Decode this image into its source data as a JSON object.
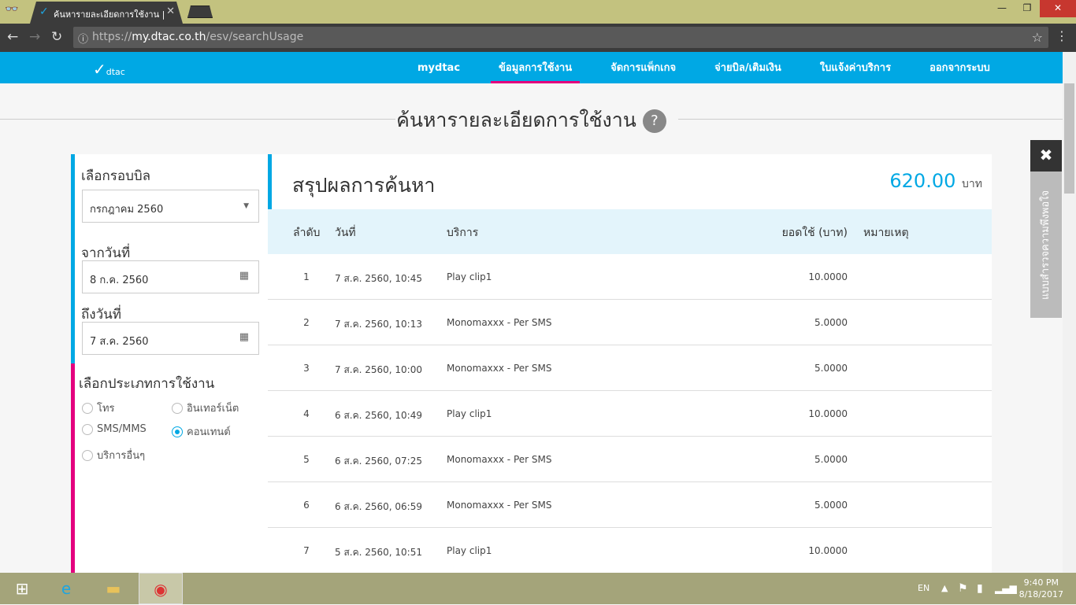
{
  "browser": {
    "tab_title": "ค้นหารายละเอียดการใช้งาน |",
    "url_scheme": "https://",
    "url_host": "my.dtac.co.th",
    "url_path": "/esv/searchUsage"
  },
  "site": {
    "logo": "dtac",
    "nav": [
      "mydtac",
      "ข้อมูลการใช้งาน",
      "จัดการแพ็กเกจ",
      "จ่ายบิล/เติมเงิน",
      "ใบแจ้งค่าบริการ",
      "ออกจากระบบ"
    ]
  },
  "page_title": "ค้นหารายละเอียดการใช้งาน",
  "help": "?",
  "filters": {
    "bill_cycle_label": "เลือกรอบบิล",
    "bill_cycle_value": "กรกฎาคม 2560",
    "from_label": "จากวันที่",
    "from_value": "8 ก.ค. 2560",
    "to_label": "ถึงวันที่",
    "to_value": "7 ส.ค. 2560",
    "type_label": "เลือกประเภทการใช้งาน",
    "types": [
      {
        "label": "โทร",
        "checked": false
      },
      {
        "label": "อินเทอร์เน็ต",
        "checked": false
      },
      {
        "label": "SMS/MMS",
        "checked": false
      },
      {
        "label": "คอนเทนต์",
        "checked": true
      },
      {
        "label": "บริการอื่นๆ",
        "checked": false
      }
    ]
  },
  "results": {
    "title": "สรุปผลการค้นหา",
    "total": "620.00",
    "currency": "บาท",
    "headers": [
      "ลำดับ",
      "วันที่",
      "บริการ",
      "ยอดใช้ (บาท)",
      "หมายเหตุ"
    ],
    "rows": [
      [
        "1",
        "7 ส.ค. 2560, 10:45",
        "Play clip1",
        "10.0000",
        ""
      ],
      [
        "2",
        "7 ส.ค. 2560, 10:13",
        "Monomaxxx - Per SMS",
        "5.0000",
        ""
      ],
      [
        "3",
        "7 ส.ค. 2560, 10:00",
        "Monomaxxx - Per SMS",
        "5.0000",
        ""
      ],
      [
        "4",
        "6 ส.ค. 2560, 10:49",
        "Play clip1",
        "10.0000",
        ""
      ],
      [
        "5",
        "6 ส.ค. 2560, 07:25",
        "Monomaxxx - Per SMS",
        "5.0000",
        ""
      ],
      [
        "6",
        "6 ส.ค. 2560, 06:59",
        "Monomaxxx - Per SMS",
        "5.0000",
        ""
      ],
      [
        "7",
        "5 ส.ค. 2560, 10:51",
        "Play clip1",
        "10.0000",
        ""
      ]
    ]
  },
  "feedback": {
    "close": "✖",
    "label": "แบบสำรวจความพึงพอใจ"
  },
  "taskbar": {
    "lang": "EN",
    "time": "9:40 PM",
    "date": "8/18/2017"
  }
}
